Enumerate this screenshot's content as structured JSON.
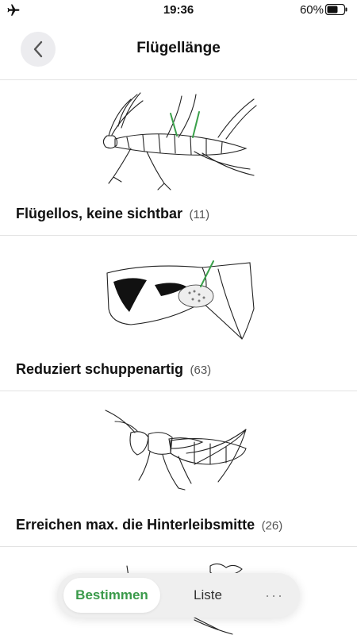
{
  "status_bar": {
    "time": "19:36",
    "battery_percent": "60%",
    "airplane_icon": "airplane-icon",
    "battery_icon": "battery-icon"
  },
  "nav": {
    "title": "Flügellänge",
    "back_icon": "chevron-left-icon"
  },
  "options": [
    {
      "label": "Flügellos, keine sichtbar",
      "count": "(11)",
      "illustration": "wingless-grasshopper-drawing"
    },
    {
      "label": "Reduziert schuppenartig",
      "count": "(63)",
      "illustration": "scale-like-wing-drawing"
    },
    {
      "label": "Erreichen max. die Hinterleibsmitte",
      "count": "(26)",
      "illustration": "short-wing-grasshopper-drawing"
    }
  ],
  "bottom_tabs": {
    "identify": "Bestimmen",
    "list": "Liste",
    "more": "···",
    "active_color": "#3a9a4a"
  },
  "colors": {
    "accent": "#3a9a4a",
    "pointer_line": "#3aa04a",
    "divider": "#e3e3e3"
  }
}
